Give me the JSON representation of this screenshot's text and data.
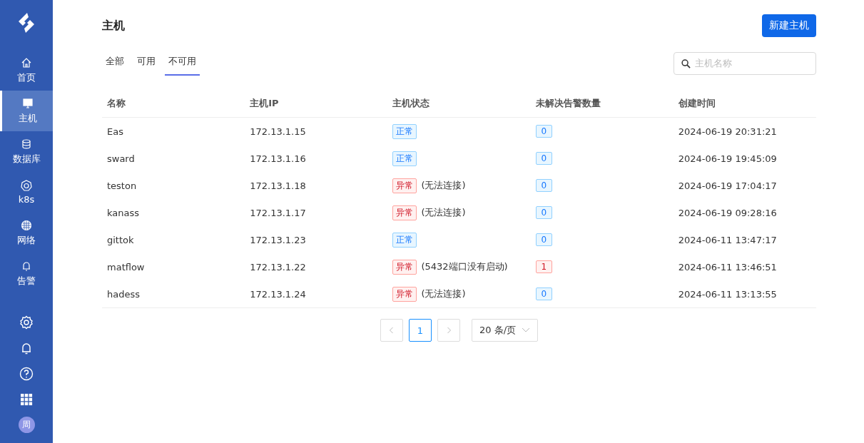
{
  "sidebar": {
    "items": [
      {
        "label": "首页",
        "selected": false
      },
      {
        "label": "主机",
        "selected": true
      },
      {
        "label": "数据库",
        "selected": false
      },
      {
        "label": "k8s",
        "selected": false
      },
      {
        "label": "网络",
        "selected": false
      },
      {
        "label": "告警",
        "selected": false
      }
    ],
    "avatar": "周"
  },
  "page": {
    "title": "主机",
    "new_button": "新建主机"
  },
  "tabs": [
    {
      "label": "全部",
      "selected": false
    },
    {
      "label": "可用",
      "selected": false
    },
    {
      "label": "不可用",
      "selected": true
    }
  ],
  "search": {
    "placeholder": "主机名称"
  },
  "table": {
    "columns": [
      "名称",
      "主机IP",
      "主机状态",
      "未解决告警数量",
      "创建时间"
    ],
    "rows": [
      {
        "name": "Eas",
        "ip": "172.13.1.15",
        "status": {
          "kind": "ok",
          "text": "正常"
        },
        "alerts": {
          "kind": "ok",
          "text": "0"
        },
        "created": "2024-06-19 20:31:21"
      },
      {
        "name": "sward",
        "ip": "172.13.1.16",
        "status": {
          "kind": "ok",
          "text": "正常"
        },
        "alerts": {
          "kind": "ok",
          "text": "0"
        },
        "created": "2024-06-19 19:45:09"
      },
      {
        "name": "teston",
        "ip": "172.13.1.18",
        "status": {
          "kind": "error",
          "text": "异常",
          "reason": "(无法连接)"
        },
        "alerts": {
          "kind": "ok",
          "text": "0"
        },
        "created": "2024-06-19 17:04:17"
      },
      {
        "name": "kanass",
        "ip": "172.13.1.17",
        "status": {
          "kind": "error",
          "text": "异常",
          "reason": "(无法连接)"
        },
        "alerts": {
          "kind": "ok",
          "text": "0"
        },
        "created": "2024-06-19 09:28:16"
      },
      {
        "name": "gittok",
        "ip": "172.13.1.23",
        "status": {
          "kind": "ok",
          "text": "正常"
        },
        "alerts": {
          "kind": "ok",
          "text": "0"
        },
        "created": "2024-06-11 13:47:17"
      },
      {
        "name": "matflow",
        "ip": "172.13.1.22",
        "status": {
          "kind": "error",
          "text": "异常",
          "reason": "(5432端口没有启动)"
        },
        "alerts": {
          "kind": "error",
          "text": "1"
        },
        "created": "2024-06-11 13:46:51"
      },
      {
        "name": "hadess",
        "ip": "172.13.1.24",
        "status": {
          "kind": "error",
          "text": "异常",
          "reason": "(无法连接)"
        },
        "alerts": {
          "kind": "ok",
          "text": "0"
        },
        "created": "2024-06-11 13:13:55"
      }
    ]
  },
  "pagination": {
    "pages": [
      {
        "label": "1",
        "selected": true
      }
    ],
    "page_size": "20 条/页"
  }
}
